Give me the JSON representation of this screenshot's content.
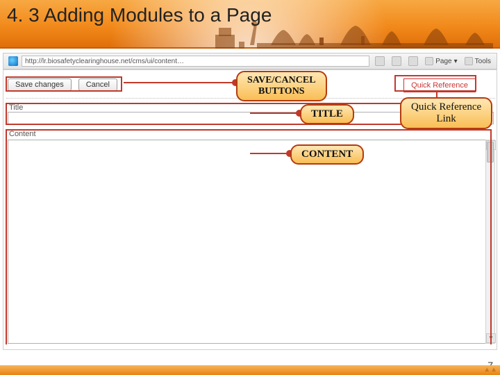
{
  "slide": {
    "title": "4. 3 Adding Modules to a Page",
    "page_number": "7"
  },
  "browser": {
    "address": "http://lr.biosafetyclearinghouse.net/cms/ui/content…",
    "page_btn": "Page",
    "tools_btn": "Tools"
  },
  "app": {
    "save_label": "Save changes",
    "cancel_label": "Cancel",
    "quick_reference_link": "Quick Reference",
    "title_section": "Title",
    "content_section": "Content"
  },
  "callouts": {
    "save_cancel": "SAVE/CANCEL\nBUTTONS",
    "title": "TITLE",
    "content": "CONTENT",
    "quick_reference": "Quick Reference\nLink"
  }
}
